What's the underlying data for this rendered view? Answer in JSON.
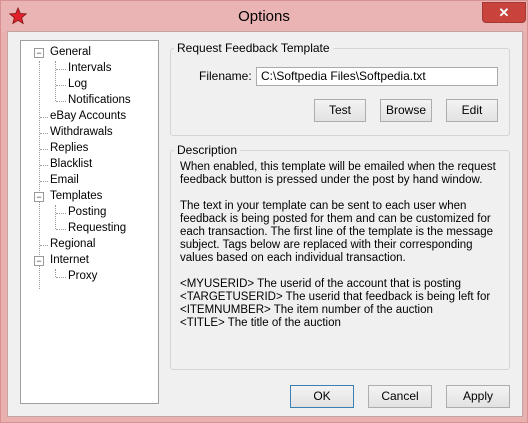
{
  "window": {
    "title": "Options",
    "close_label": "✕"
  },
  "tree": {
    "items": [
      {
        "label": "General",
        "level": 0,
        "toggle": "−"
      },
      {
        "label": "Intervals",
        "level": 1
      },
      {
        "label": "Log",
        "level": 1
      },
      {
        "label": "Notifications",
        "level": 1
      },
      {
        "label": "eBay Accounts",
        "level": 0
      },
      {
        "label": "Withdrawals",
        "level": 0
      },
      {
        "label": "Replies",
        "level": 0
      },
      {
        "label": "Blacklist",
        "level": 0
      },
      {
        "label": "Email",
        "level": 0
      },
      {
        "label": "Templates",
        "level": 0,
        "toggle": "−"
      },
      {
        "label": "Posting",
        "level": 1
      },
      {
        "label": "Requesting",
        "level": 1
      },
      {
        "label": "Regional",
        "level": 0
      },
      {
        "label": "Internet",
        "level": 0,
        "toggle": "−"
      },
      {
        "label": "Proxy",
        "level": 1
      }
    ]
  },
  "template_group": {
    "title": "Request Feedback Template",
    "filename_label": "Filename:",
    "filename_value": "C:\\Softpedia Files\\Softpedia.txt",
    "test_label": "Test",
    "browse_label": "Browse",
    "edit_label": "Edit"
  },
  "description_group": {
    "title": "Description",
    "para1": "When enabled, this template will be emailed when the request\nfeedback button is pressed under the post by hand window.",
    "para2": "The text in your template can be sent to each user when\nfeedback is being posted for them and can be customized for\neach transaction.  The first line of the template is the message\nsubject.  Tags below are replaced with their corresponding\nvalues based on each individual transaction.",
    "tags": [
      "<MYUSERID>  The userid of the account that is posting",
      "<TARGETUSERID>  The userid that feedback is being left for",
      "<ITEMNUMBER>  The item number of the auction",
      "<TITLE>  The title of the auction"
    ]
  },
  "footer": {
    "ok_label": "OK",
    "cancel_label": "Cancel",
    "apply_label": "Apply"
  },
  "colors": {
    "title_bar": "#eab3b4",
    "close_button": "#c7433c",
    "app_icon": "#e0202a"
  }
}
